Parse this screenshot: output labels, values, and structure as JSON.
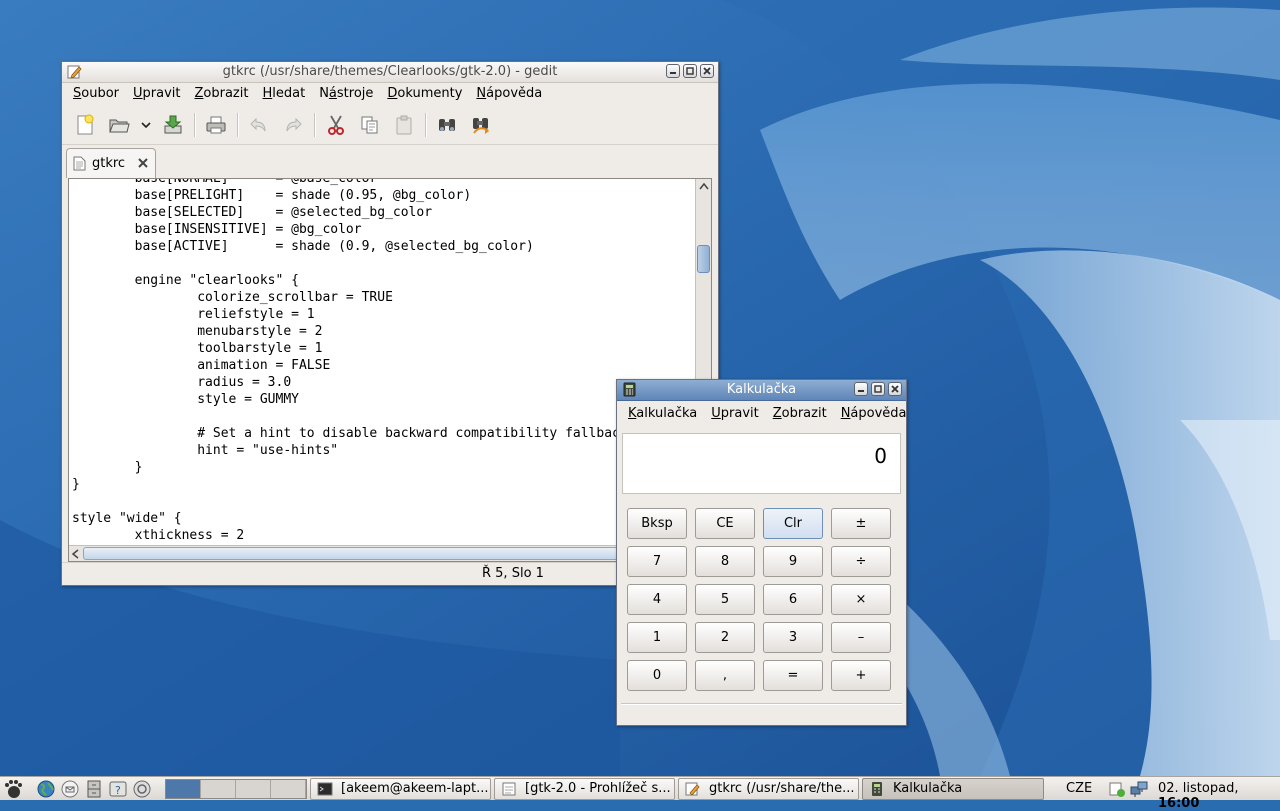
{
  "gedit": {
    "title": "gtkrc (/usr/share/themes/Clearlooks/gtk-2.0) - gedit",
    "menu": [
      {
        "pre": "",
        "ul": "S",
        "post": "oubor"
      },
      {
        "pre": "",
        "ul": "U",
        "post": "pravit"
      },
      {
        "pre": "",
        "ul": "Z",
        "post": "obrazit"
      },
      {
        "pre": "",
        "ul": "H",
        "post": "ledat"
      },
      {
        "pre": "N",
        "ul": "á",
        "post": "stroje"
      },
      {
        "pre": "",
        "ul": "D",
        "post": "okumenty"
      },
      {
        "pre": "",
        "ul": "N",
        "post": "ápověda"
      }
    ],
    "tab_label": "gtkrc",
    "code": "        base[NORMAL]      = @base_color\n        base[PRELIGHT]    = shade (0.95, @bg_color)\n        base[SELECTED]    = @selected_bg_color\n        base[INSENSITIVE] = @bg_color\n        base[ACTIVE]      = shade (0.9, @selected_bg_color)\n\n        engine \"clearlooks\" {\n                colorize_scrollbar = TRUE\n                reliefstyle = 1\n                menubarstyle = 2\n                toolbarstyle = 1\n                animation = FALSE\n                radius = 3.0\n                style = GUMMY\n\n                # Set a hint to disable backward compatibility fallbacks.\n                hint = \"use-hints\"\n        }\n}\n\nstyle \"wide\" {\n        xthickness = 2",
    "status_position": "Ř 5, Slo 1"
  },
  "calc": {
    "title": "Kalkulačka",
    "menu": [
      {
        "pre": "",
        "ul": "K",
        "post": "alkulačka"
      },
      {
        "pre": "",
        "ul": "U",
        "post": "pravit"
      },
      {
        "pre": "",
        "ul": "Z",
        "post": "obrazit"
      },
      {
        "pre": "",
        "ul": "N",
        "post": "ápověda"
      }
    ],
    "display": "0",
    "keys": [
      "Bksp",
      "CE",
      "Clr",
      "±",
      "7",
      "8",
      "9",
      "÷",
      "4",
      "5",
      "6",
      "×",
      "1",
      "2",
      "3",
      "–",
      "0",
      ",",
      "=",
      "+"
    ]
  },
  "panel": {
    "tasks": [
      "[akeem@akeem-lapt...",
      "[gtk-2.0 - Prohlížeč s...",
      "gtkrc (/usr/share/the...",
      "Kalkulačka"
    ],
    "keyboard_layout": "CZE",
    "clock_date": "02. listopad, ",
    "clock_time": "16:00"
  }
}
